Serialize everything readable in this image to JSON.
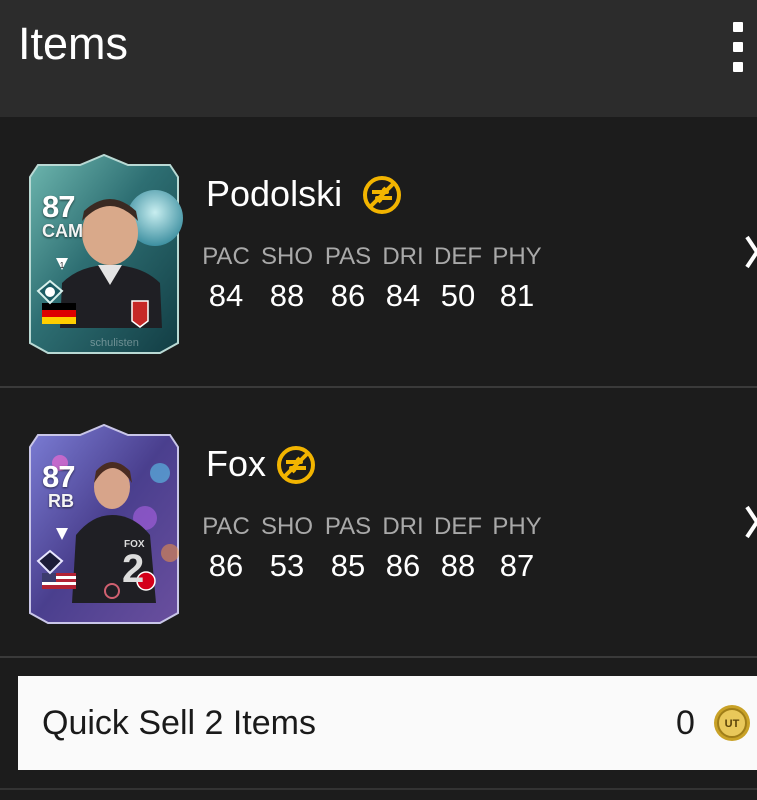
{
  "header": {
    "title": "Items"
  },
  "stat_labels": [
    "PAC",
    "SHO",
    "PAS",
    "DRI",
    "DEF",
    "PHY"
  ],
  "players": [
    {
      "name": "Podolski",
      "rating": "87",
      "position": "CAM",
      "stats": [
        "84",
        "88",
        "86",
        "84",
        "50",
        "81"
      ],
      "nation_flag": "germany-flag",
      "card_color": "#2a6e6e",
      "watermark": "schulisten"
    },
    {
      "name": "Fox",
      "rating": "87",
      "position": "RB",
      "stats": [
        "86",
        "53",
        "85",
        "86",
        "88",
        "87"
      ],
      "nation_flag": "usa-flag",
      "card_color": "#5a4fa0",
      "kit_name": "FOX",
      "kit_number": "2"
    }
  ],
  "quick_sell": {
    "label": "Quick Sell 2 Items",
    "amount": "0",
    "coin_text": "UT"
  },
  "colors": {
    "badge": "#f2b400",
    "header_bg": "#2c2c2c",
    "row_bg": "#1c1c1c"
  }
}
